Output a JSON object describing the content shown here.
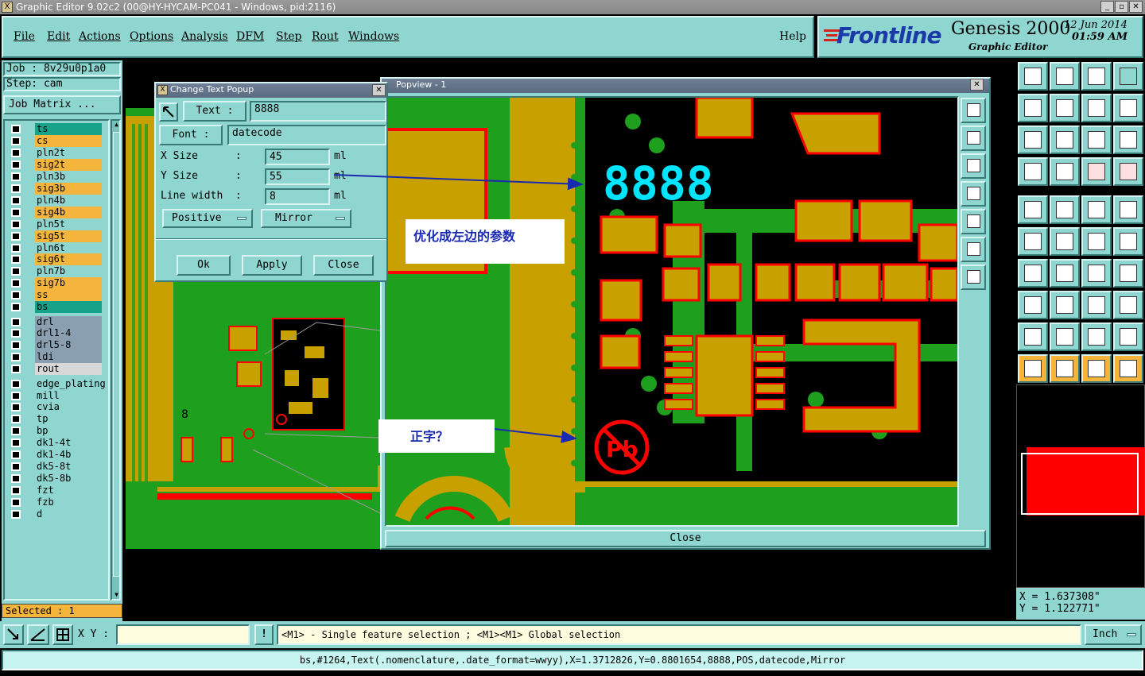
{
  "window": {
    "title": "Graphic Editor 9.02c2 (00@HY-HYCAM-PC041 - Windows, pid:2116)"
  },
  "menu": [
    "File",
    "Edit",
    "Actions",
    "Options",
    "Analysis",
    "DFM",
    "Step",
    "Rout",
    "Windows"
  ],
  "help_label": "Help",
  "brand": {
    "logo": "Frontline",
    "product": "Genesis 2000",
    "subtitle": "Graphic Editor",
    "date": "12 Jun 2014",
    "time": "01:59 AM"
  },
  "job": {
    "job_label": "Job : 8v29u0p1a0",
    "step_label": "Step: cam",
    "matrix_button": "Job Matrix ..."
  },
  "layers": [
    {
      "name": "ts",
      "color": "#17a38a"
    },
    {
      "name": "cs",
      "color": "#f5b53c"
    },
    {
      "name": "pln2t",
      "color": "#8fd6d0"
    },
    {
      "name": "sig2t",
      "color": "#f5b53c"
    },
    {
      "name": "pln3b",
      "color": "#8fd6d0"
    },
    {
      "name": "sig3b",
      "color": "#f5b53c"
    },
    {
      "name": "pln4b",
      "color": "#8fd6d0"
    },
    {
      "name": "sig4b",
      "color": "#f5b53c"
    },
    {
      "name": "pln5t",
      "color": "#8fd6d0"
    },
    {
      "name": "sig5t",
      "color": "#f5b53c"
    },
    {
      "name": "pln6t",
      "color": "#8fd6d0"
    },
    {
      "name": "sig6t",
      "color": "#f5b53c"
    },
    {
      "name": "pln7b",
      "color": "#8fd6d0"
    },
    {
      "name": "sig7b",
      "color": "#f5b53c"
    },
    {
      "name": "ss",
      "color": "#f5b53c"
    },
    {
      "name": "bs",
      "color": "#17a38a"
    },
    {
      "name": "drl",
      "color": "#8aa0b0"
    },
    {
      "name": "drl1-4",
      "color": "#8aa0b0"
    },
    {
      "name": "drl5-8",
      "color": "#8aa0b0"
    },
    {
      "name": "ldi",
      "color": "#8aa0b0"
    },
    {
      "name": "rout",
      "color": "#d8d8d8"
    },
    {
      "name": "edge_plating",
      "color": "#8fd6d0"
    },
    {
      "name": "mill",
      "color": "#8fd6d0"
    },
    {
      "name": "cvia",
      "color": "#8fd6d0"
    },
    {
      "name": "tp",
      "color": "#8fd6d0"
    },
    {
      "name": "bp",
      "color": "#8fd6d0"
    },
    {
      "name": "dk1-4t",
      "color": "#8fd6d0"
    },
    {
      "name": "dk1-4b",
      "color": "#8fd6d0"
    },
    {
      "name": "dk5-8t",
      "color": "#8fd6d0"
    },
    {
      "name": "dk5-8b",
      "color": "#8fd6d0"
    },
    {
      "name": "fzt",
      "color": "#8fd6d0"
    },
    {
      "name": "fzb",
      "color": "#8fd6d0"
    },
    {
      "name": "d",
      "color": "#8fd6d0"
    }
  ],
  "selected_label": "Selected : 1",
  "change_text": {
    "title": "Change Text Popup",
    "text_label": "Text :",
    "text_value": "8888",
    "font_label": "Font :",
    "font_value": "datecode",
    "xsize_label": "X Size      :",
    "xsize_value": "45",
    "unit": "ml",
    "ysize_label": "Y Size      :",
    "ysize_value": "55",
    "lw_label": "Line width  :",
    "lw_value": "8",
    "polarity": "Positive",
    "mirror": "Mirror",
    "ok": "Ok",
    "apply": "Apply",
    "close": "Close"
  },
  "popview": {
    "title": "Popview - 1",
    "close": "Close",
    "pcb_text": "8888",
    "pb_text": "Pb",
    "small_text": "8"
  },
  "annotations": {
    "a1": "优化成左边的参数",
    "a2": "正字？"
  },
  "coords": {
    "x": "X = 1.637308\"",
    "y": "Y = 1.122771\""
  },
  "bottom": {
    "xy_label": "X Y :",
    "hint": "<M1> - Single feature selection ; <M1><M1> Global selection",
    "units": "Inch"
  },
  "status": "bs,#1264,Text(.nomenclature,.date_format=wwyy),X=1.3712826,Y=0.8801654,8888,POS,datecode,Mirror",
  "colors": {
    "pad": "#c8a000",
    "copper": "#1ea01e",
    "outline": "#ff0000",
    "text": "#00e5ff",
    "ui": "#8fd6d0"
  }
}
